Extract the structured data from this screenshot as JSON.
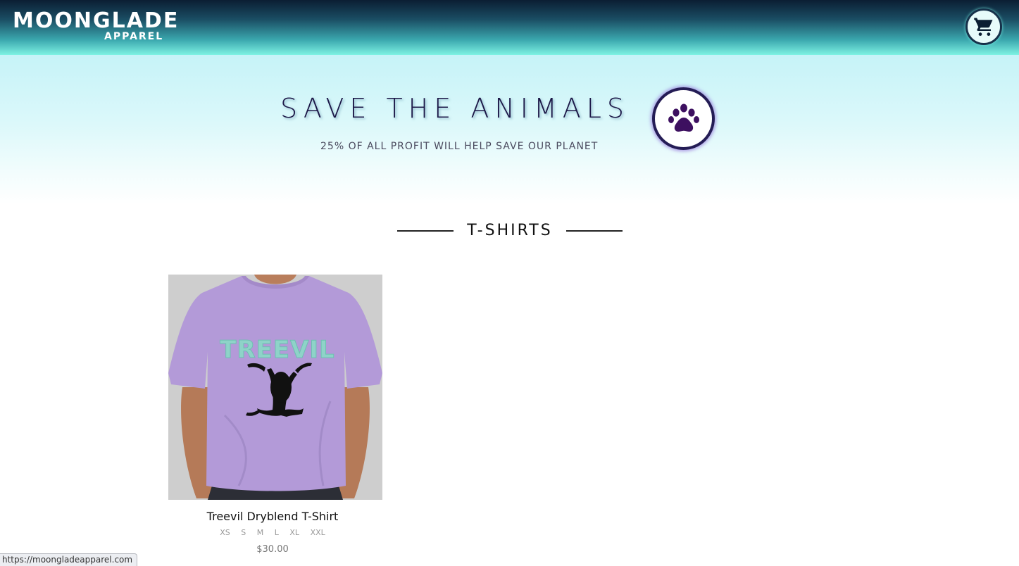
{
  "header": {
    "logo_main": "MOONGLADE",
    "logo_sub": "APPAREL",
    "cart_icon": "shopping-cart-icon"
  },
  "hero": {
    "title": "SAVE THE ANIMALS",
    "subtitle": "25% OF ALL PROFIT WILL HELP SAVE OUR PLANET",
    "badge_icon": "paw-icon"
  },
  "section": {
    "title": "T-SHIRTS"
  },
  "products": [
    {
      "name": "Treevil Dryblend T-Shirt",
      "sizes": [
        "XS",
        "S",
        "M",
        "L",
        "XL",
        "XXL"
      ],
      "price": "$30.00",
      "graphic_text": "TREEVIL"
    }
  ],
  "status_bar": {
    "url": "https://moongladeapparel.com"
  },
  "colors": {
    "header_dark": "#0b1e33",
    "header_light": "#7ef2e3",
    "hero_bg": "#c6f3f8",
    "accent_navy": "#1c1747",
    "paw_purple": "#3d1060",
    "shirt_purple": "#b39ad8"
  }
}
